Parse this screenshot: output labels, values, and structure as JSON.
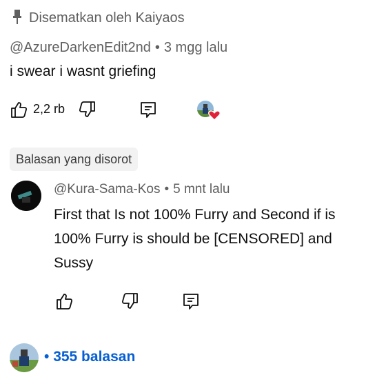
{
  "pinned": {
    "label": "Disematkan oleh Kaiyaos"
  },
  "comment": {
    "author": "@AzureDarkenEdit2nd",
    "time": "3 mgg lalu",
    "text": "i swear i wasnt griefing",
    "likes": "2,2 rb"
  },
  "highlight": {
    "label": "Balasan yang disorot"
  },
  "reply": {
    "author": "@Kura-Sama-Kos",
    "time": "5 mnt lalu",
    "lines": [
      "First that Is not 100% Furry and Second if is",
      "100% Furry is should be [CENSORED] and",
      "Sussy"
    ]
  },
  "replies": {
    "count_label": "355 balasan"
  },
  "colors": {
    "link": "#065fd4",
    "heart": "#e0223a",
    "muted": "#606060"
  },
  "icons": [
    "pin-icon",
    "like-icon",
    "dislike-icon",
    "reply-icon",
    "heart-icon"
  ]
}
